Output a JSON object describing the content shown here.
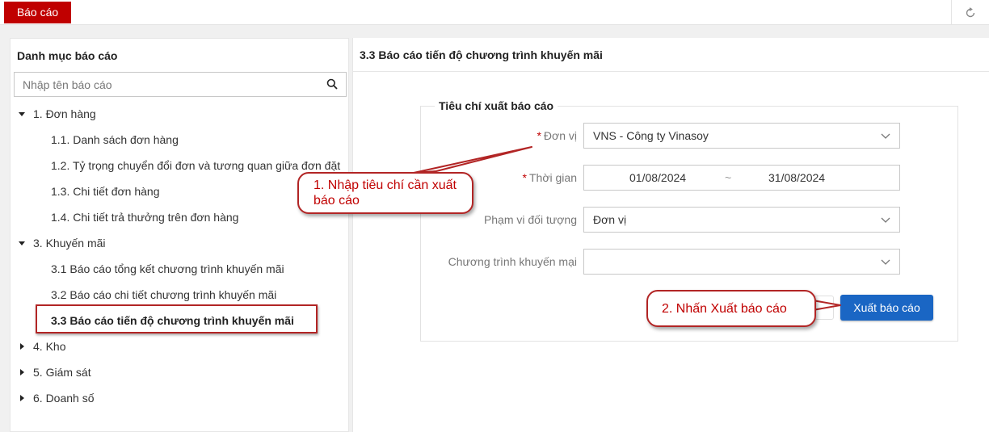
{
  "topbar": {
    "active_tab": "Báo cáo",
    "refresh_icon": "refresh-icon"
  },
  "sidebar": {
    "title": "Danh mục báo cáo",
    "search": {
      "placeholder": "Nhập tên báo cáo",
      "value": "",
      "icon": "search-icon"
    },
    "groups": [
      {
        "label": "1. Đơn hàng",
        "expanded": true,
        "items": [
          {
            "label": "1.1. Danh sách đơn hàng"
          },
          {
            "label": "1.2. Tỷ trọng chuyển đổi đơn và tương quan giữa đơn đặt"
          },
          {
            "label": "1.3. Chi tiết đơn hàng"
          },
          {
            "label": "1.4. Chi tiết trả thưởng trên đơn hàng"
          }
        ]
      },
      {
        "label": "3. Khuyến mãi",
        "expanded": true,
        "items": [
          {
            "label": "3.1 Báo cáo tổng kết chương trình khuyến mãi"
          },
          {
            "label": "3.2 Báo cáo chi tiết chương trình khuyến mãi"
          },
          {
            "label": "3.3 Báo cáo tiến độ chương trình khuyến mãi",
            "selected": true
          }
        ]
      },
      {
        "label": "4. Kho",
        "expanded": false
      },
      {
        "label": "5. Giám sát",
        "expanded": false
      },
      {
        "label": "6. Doanh số",
        "expanded": false
      }
    ]
  },
  "main": {
    "title": "3.3 Báo cáo tiến độ chương trình khuyến mãi",
    "criteria_title": "Tiêu chí xuất báo cáo",
    "fields": {
      "unit": {
        "required_mark": "*",
        "label": "Đơn vị",
        "value": "VNS - Công ty Vinasoy"
      },
      "time": {
        "required_mark": "*",
        "label": "Thời gian",
        "from": "01/08/2024",
        "separator": "~",
        "to": "31/08/2024"
      },
      "scope": {
        "label": "Phạm vi đối tượng",
        "value": "Đơn vị"
      },
      "program": {
        "label": "Chương trình khuyến mại",
        "value": ""
      }
    },
    "export_button": "Xuất báo cáo"
  },
  "annotations": {
    "callout_1": "1. Nhập tiêu chí cần xuất báo cáo",
    "callout_2": "2. Nhấn Xuất báo cáo"
  },
  "colors": {
    "brand_red": "#c00000",
    "primary_blue": "#1a66c4",
    "highlight_border": "#b22525"
  }
}
